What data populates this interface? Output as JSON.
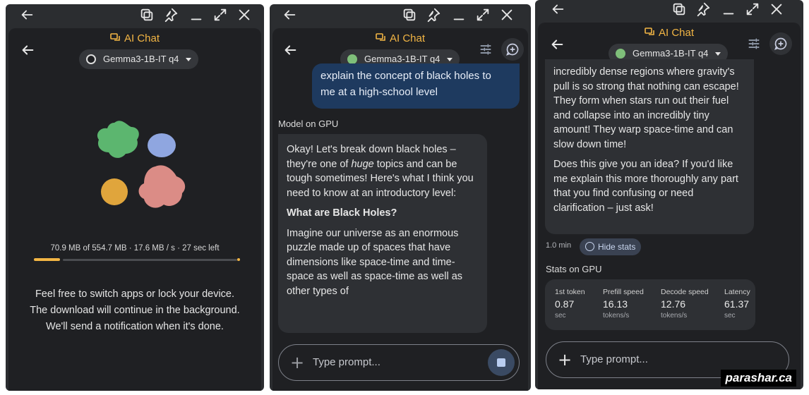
{
  "app": {
    "title": "AI Chat",
    "model_name": "Gemma3-1B-IT q4"
  },
  "panel1": {
    "download_status": "70.9 MB of 554.7 MB · 17.6 MB / s · 27 sec left",
    "download_progress": 0.128,
    "note_lines": [
      "Feel free to switch apps or lock your device.",
      "The download will continue in the background.",
      "We'll send a notification when it's done."
    ]
  },
  "panel2": {
    "user_message_lines": [
      "explain the concept of black holes to",
      "me at a high-school level"
    ],
    "model_label": "Model on GPU",
    "response": {
      "intro_before": "Okay! Let's break down black holes – they're one of ",
      "intro_emph": "huge",
      "intro_after": " topics and can be tough sometimes! Here's what I think you need to know at an introductory level:",
      "heading": "What are Black Holes?",
      "body": "Imagine our universe as an enormous puzzle made up of spaces that have dimensions like space-time and time-space as well as space-time as well as other types of"
    },
    "input_placeholder": "Type prompt..."
  },
  "panel3": {
    "response_p1": "incredibly dense regions where gravity's pull is so strong that nothing can escape! They form when stars run out their fuel and collapse into an incredibly tiny amount! They warp space-time and can slow down time!",
    "response_p2": "Does this give you an idea? If you'd like me explain this more thoroughly any part that you find confusing or need clarification – just ask!",
    "elapsed": "1.0 min",
    "hide_stats_label": "Hide stats",
    "stats_title": "Stats on GPU",
    "stats": [
      {
        "label": "1st token",
        "value": "0.87",
        "unit": "sec"
      },
      {
        "label": "Prefill speed",
        "value": "16.13",
        "unit": "tokens/s"
      },
      {
        "label": "Decode speed",
        "value": "12.76",
        "unit": "tokens/s"
      },
      {
        "label": "Latency",
        "value": "61.37",
        "unit": "sec"
      }
    ],
    "input_placeholder": "Type prompt..."
  },
  "watermark": "parashar.ca",
  "colors": {
    "accent": "#f2b544",
    "user_bubble": "#1e3a5f",
    "model_bubble": "#2e3034",
    "blob_green": "#5cb66f",
    "blob_blue": "#8fa6e0",
    "blob_orange": "#e0a53c",
    "blob_pink": "#db8c86"
  }
}
